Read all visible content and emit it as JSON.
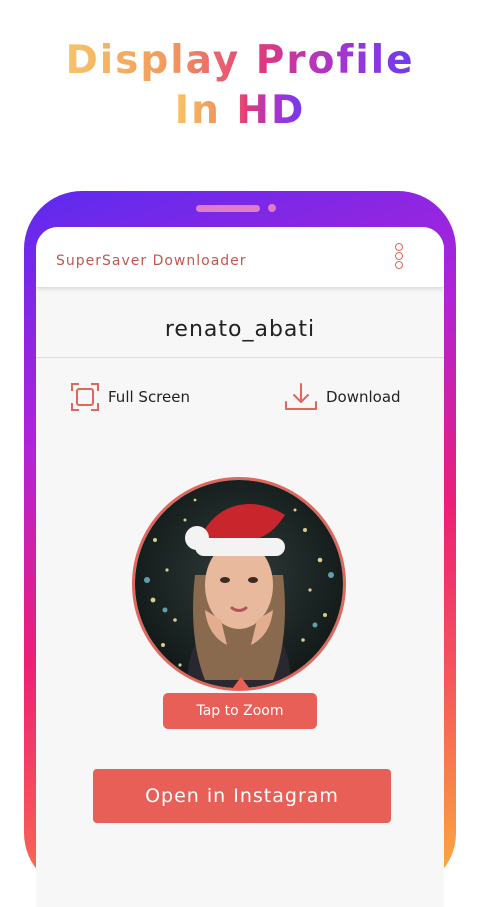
{
  "headline": {
    "line1": "Display Profile",
    "line2": "In HD"
  },
  "app": {
    "title": "SuperSaver Downloader",
    "menu_icon": "kebab-menu-icon"
  },
  "profile": {
    "username": "renato_abati"
  },
  "actions": {
    "full_screen_label": "Full Screen",
    "full_screen_icon": "fullscreen-icon",
    "download_label": "Download",
    "download_icon": "download-icon"
  },
  "buttons": {
    "tap_to_zoom": "Tap to Zoom",
    "open_instagram": "Open in Instagram"
  },
  "colors": {
    "accent": "#e85f57",
    "title_text": "#c0584f"
  }
}
